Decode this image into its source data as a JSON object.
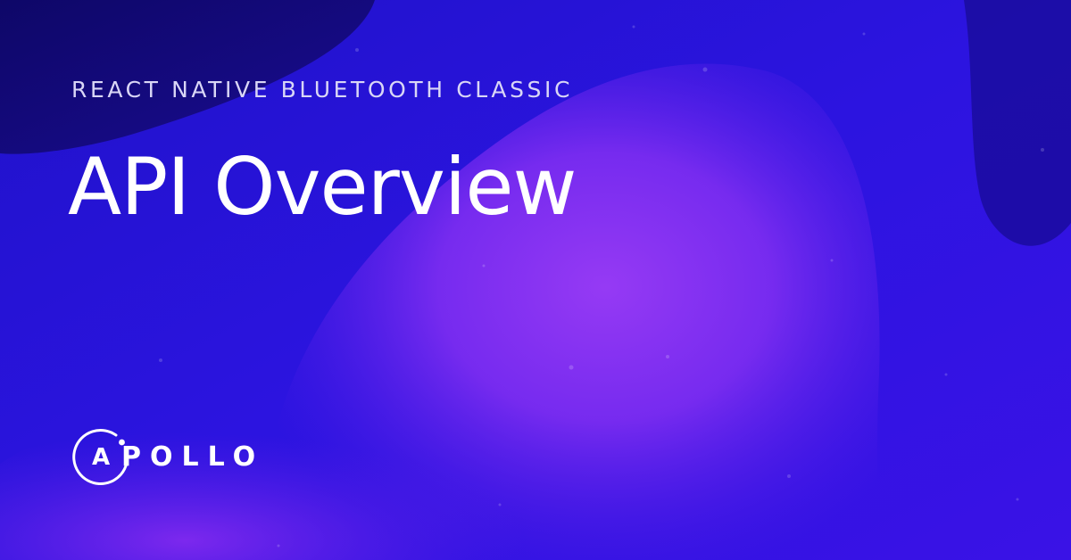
{
  "eyebrow": "REACT NATIVE BLUETOOTH CLASSIC",
  "title": "API Overview",
  "logo": {
    "first_letter": "A",
    "rest_letters": "POLLO",
    "icon": "apollo-ring-icon"
  },
  "colors": {
    "background_blue": "#2a10d8",
    "background_violet": "#8a2ff2",
    "dark_navy": "#14087a",
    "title_text": "#ffffff",
    "eyebrow_text": "#d9d6f6"
  }
}
